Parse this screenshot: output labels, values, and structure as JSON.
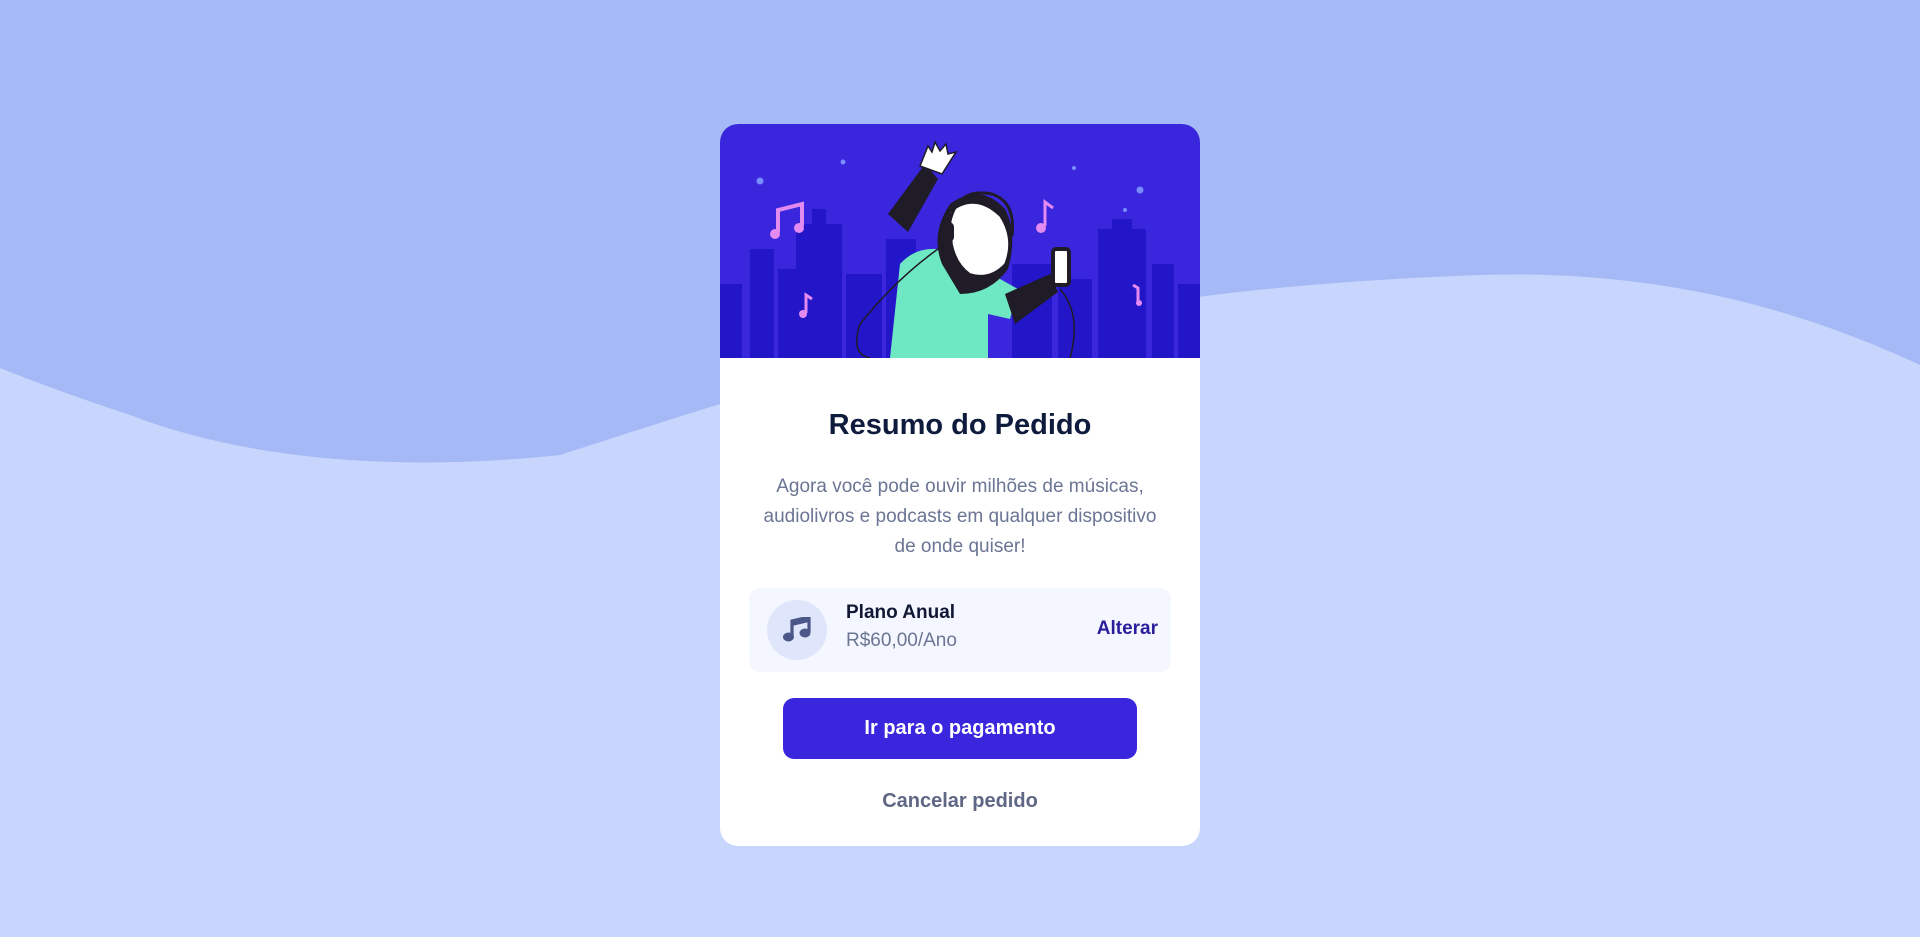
{
  "order_card": {
    "title": "Resumo do Pedido",
    "description": "Agora você pode ouvir milhões de músicas, audiolivros e podcasts em qualquer dispositivo de onde quiser!",
    "plan": {
      "icon": "music-note-icon",
      "name": "Plano Anual",
      "price": "R$60,00/Ano",
      "change_label": "Alterar"
    },
    "pay_button_label": "Ir para o pagamento",
    "cancel_label": "Cancelar pedido"
  },
  "colors": {
    "background_light": "#c8d6fd",
    "background_wave": "#a5b9f6",
    "hero_background": "#3a26dd",
    "primary_button": "#3a26dd",
    "link": "#2a1e9a",
    "card": "#ffffff"
  }
}
